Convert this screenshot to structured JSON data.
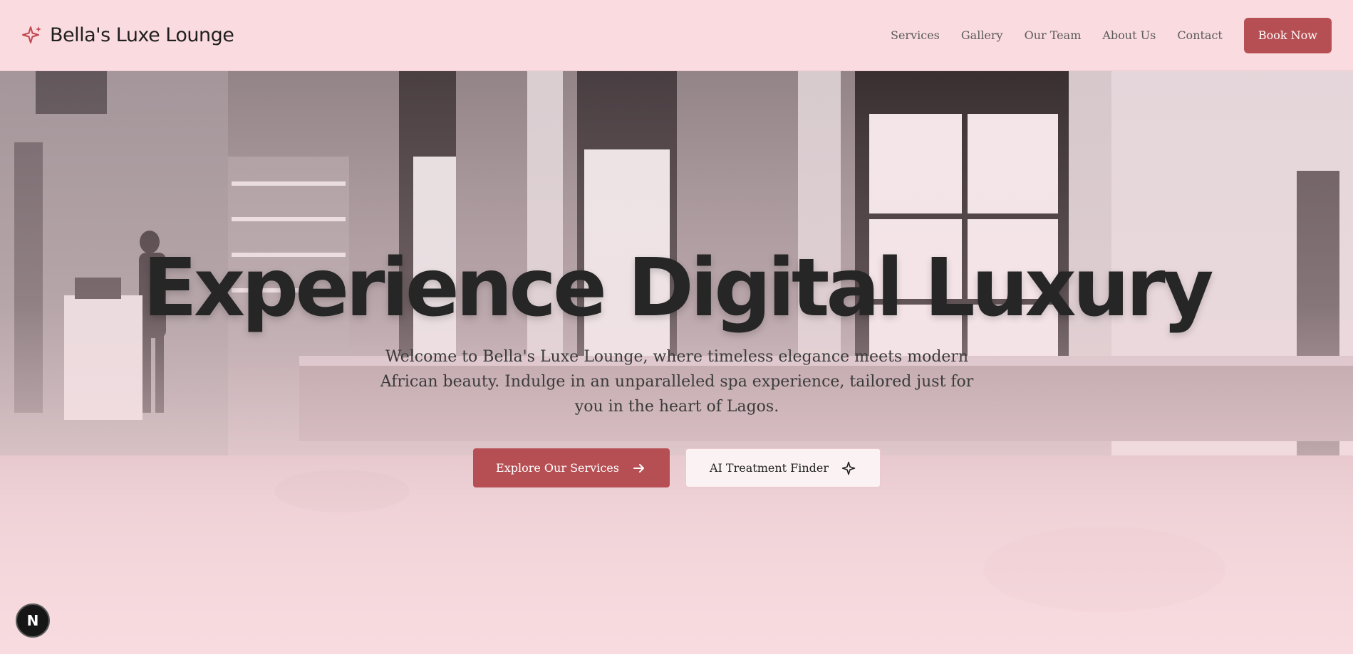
{
  "brand": {
    "name": "Bella's Luxe Lounge",
    "icon": "sparkle-icon",
    "accent_color": "#b64f53"
  },
  "nav": {
    "items": [
      {
        "label": "Services"
      },
      {
        "label": "Gallery"
      },
      {
        "label": "Our Team"
      },
      {
        "label": "About Us"
      },
      {
        "label": "Contact"
      }
    ],
    "cta_label": "Book Now"
  },
  "hero": {
    "title": "Experience Digital Luxury",
    "subtitle": "Welcome to Bella's Luxe Lounge, where timeless elegance meets modern African beauty. Indulge in an unparalleled spa experience, tailored just for you in the heart of Lagos.",
    "primary_button": {
      "label": "Explore Our Services",
      "icon": "arrow-right-icon"
    },
    "secondary_button": {
      "label": "AI Treatment Finder",
      "icon": "sparkle-icon"
    },
    "background": "salon-interior-photo"
  },
  "floating_badge": {
    "label": "N"
  },
  "colors": {
    "header_bg": "#fadbe0",
    "button_primary": "#b64f53",
    "text_dark": "#262626"
  }
}
